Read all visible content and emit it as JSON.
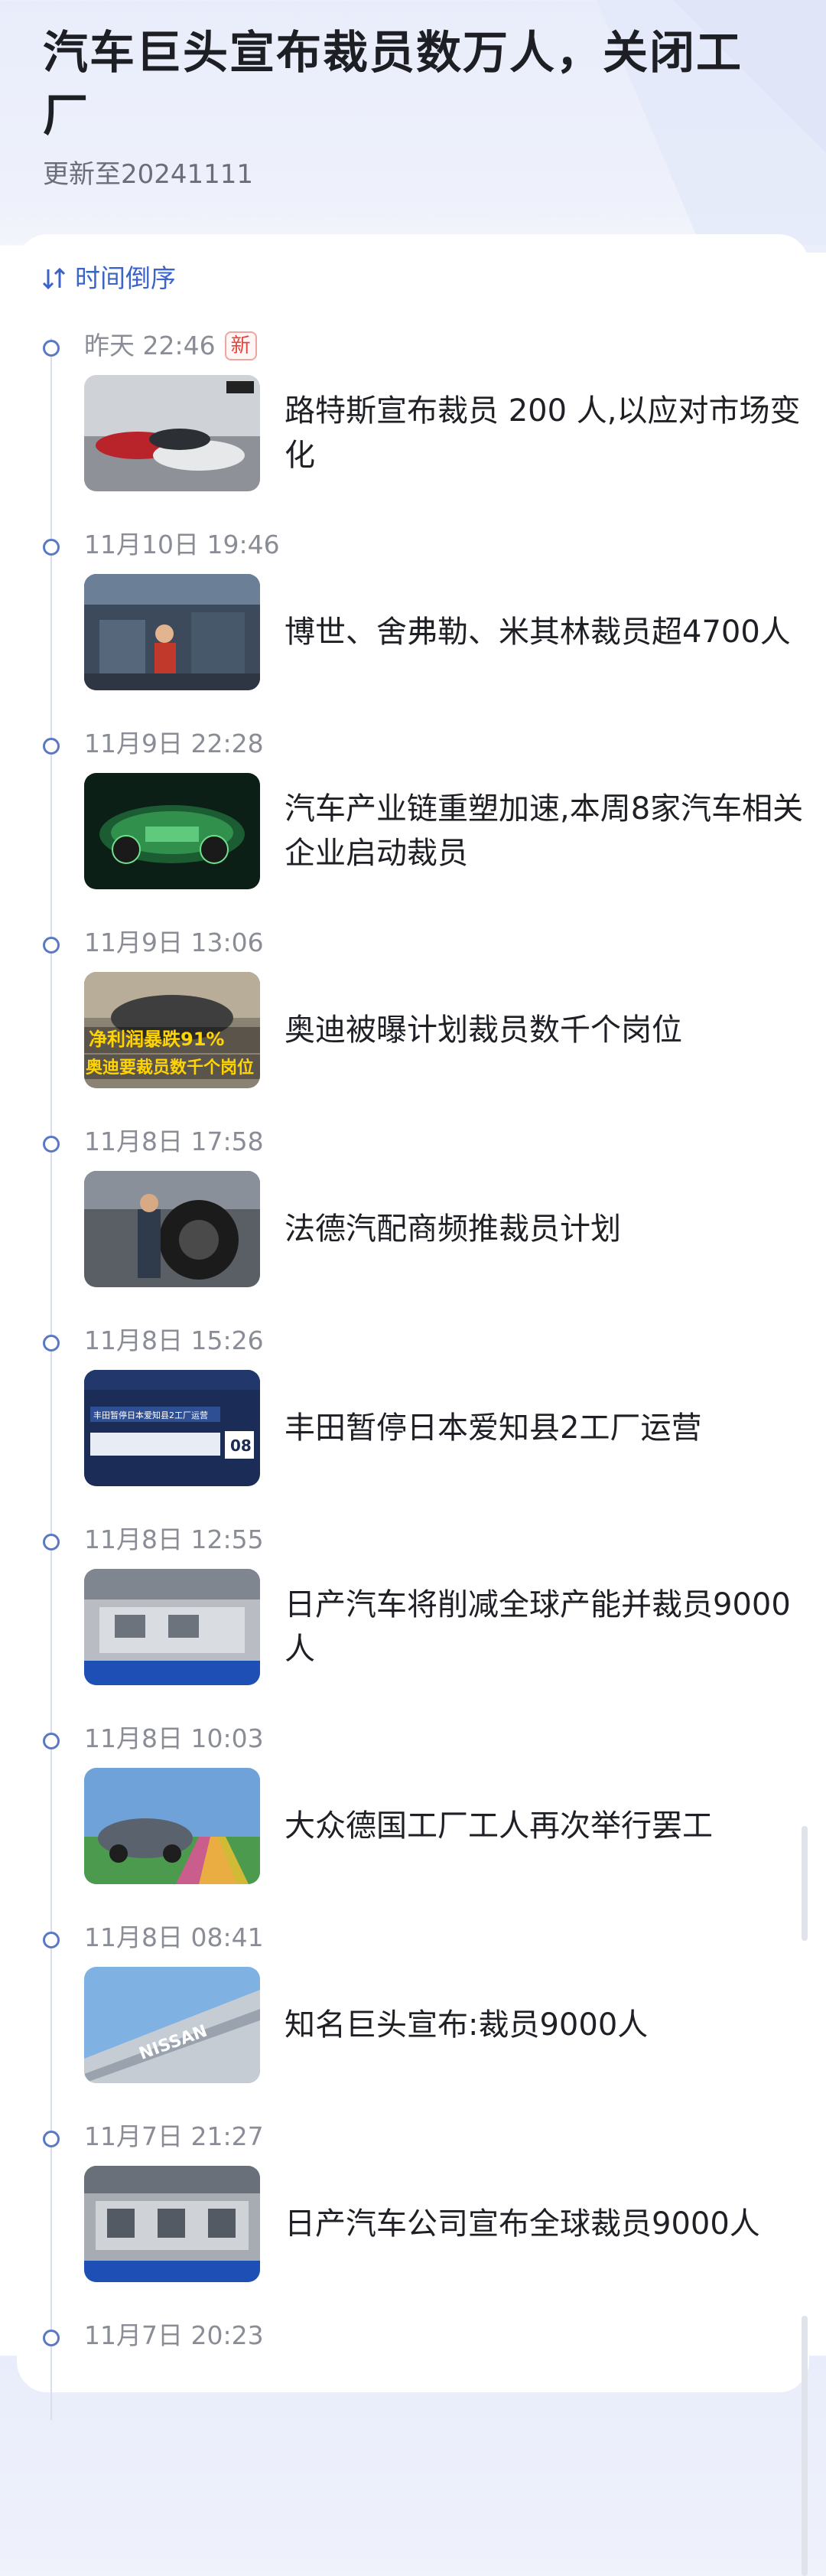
{
  "header": {
    "title": "汽车巨头宣布裁员数万人，关闭工厂",
    "updated": "更新至20241111"
  },
  "sort": {
    "label": "时间倒序",
    "icon": "sort-order-icon"
  },
  "colors": {
    "accent": "#3a64c8",
    "new_badge": "#e0473e",
    "time_text": "#8a8d96"
  },
  "news": [
    {
      "time": "昨天 22:46",
      "badge": "新",
      "headline": "路特斯宣布裁员 200 人,以应对市场变化",
      "thumb": "sports-cars"
    },
    {
      "time": "11月10日 19:46",
      "headline": "博世、舍弗勒、米其林裁员超4700人",
      "thumb": "factory-workers"
    },
    {
      "time": "11月9日 22:28",
      "headline": "汽车产业链重塑加速,本周8家汽车相关企业启动裁员",
      "thumb": "green-car-chassis"
    },
    {
      "time": "11月9日 13:06",
      "headline": "奥迪被曝计划裁员数千个岗位",
      "thumb": "audi-headline",
      "thumb_text": [
        "净利润暴跌91%",
        "奥迪要裁员数千个岗位"
      ]
    },
    {
      "time": "11月8日 17:58",
      "headline": "法德汽配商频推裁员计划",
      "thumb": "tire-factory"
    },
    {
      "time": "11月8日 15:26",
      "headline": "丰田暂停日本爱知县2工厂运营",
      "thumb": "news-broadcast",
      "thumb_text": [
        "丰田暂停日本爱知县2工厂运营",
        "08"
      ]
    },
    {
      "time": "11月8日 12:55",
      "headline": "日产汽车将削减全球产能并裁员9000人",
      "thumb": "assembly-line"
    },
    {
      "time": "11月8日 10:03",
      "headline": "大众德国工厂工人再次举行罢工",
      "thumb": "vw-car"
    },
    {
      "time": "11月8日 08:41",
      "headline": "知名巨头宣布:裁员9000人",
      "thumb": "nissan-building",
      "thumb_text": [
        "NISSAN"
      ]
    },
    {
      "time": "11月7日 21:27",
      "headline": "日产汽车公司宣布全球裁员9000人",
      "thumb": "assembly-line-2"
    },
    {
      "time": "11月7日 20:23",
      "headline": "",
      "thumb": ""
    }
  ]
}
